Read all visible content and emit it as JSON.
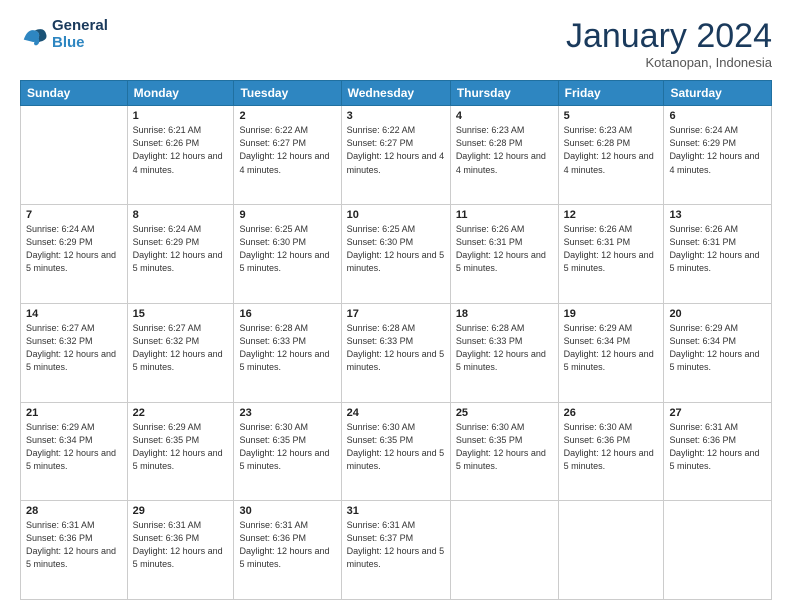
{
  "logo": {
    "line1": "General",
    "line2": "Blue"
  },
  "title": "January 2024",
  "subtitle": "Kotanopan, Indonesia",
  "days_header": [
    "Sunday",
    "Monday",
    "Tuesday",
    "Wednesday",
    "Thursday",
    "Friday",
    "Saturday"
  ],
  "weeks": [
    [
      {
        "num": "",
        "sunrise": "",
        "sunset": "",
        "daylight": ""
      },
      {
        "num": "1",
        "sunrise": "Sunrise: 6:21 AM",
        "sunset": "Sunset: 6:26 PM",
        "daylight": "Daylight: 12 hours and 4 minutes."
      },
      {
        "num": "2",
        "sunrise": "Sunrise: 6:22 AM",
        "sunset": "Sunset: 6:27 PM",
        "daylight": "Daylight: 12 hours and 4 minutes."
      },
      {
        "num": "3",
        "sunrise": "Sunrise: 6:22 AM",
        "sunset": "Sunset: 6:27 PM",
        "daylight": "Daylight: 12 hours and 4 minutes."
      },
      {
        "num": "4",
        "sunrise": "Sunrise: 6:23 AM",
        "sunset": "Sunset: 6:28 PM",
        "daylight": "Daylight: 12 hours and 4 minutes."
      },
      {
        "num": "5",
        "sunrise": "Sunrise: 6:23 AM",
        "sunset": "Sunset: 6:28 PM",
        "daylight": "Daylight: 12 hours and 4 minutes."
      },
      {
        "num": "6",
        "sunrise": "Sunrise: 6:24 AM",
        "sunset": "Sunset: 6:29 PM",
        "daylight": "Daylight: 12 hours and 4 minutes."
      }
    ],
    [
      {
        "num": "7",
        "sunrise": "Sunrise: 6:24 AM",
        "sunset": "Sunset: 6:29 PM",
        "daylight": "Daylight: 12 hours and 5 minutes."
      },
      {
        "num": "8",
        "sunrise": "Sunrise: 6:24 AM",
        "sunset": "Sunset: 6:29 PM",
        "daylight": "Daylight: 12 hours and 5 minutes."
      },
      {
        "num": "9",
        "sunrise": "Sunrise: 6:25 AM",
        "sunset": "Sunset: 6:30 PM",
        "daylight": "Daylight: 12 hours and 5 minutes."
      },
      {
        "num": "10",
        "sunrise": "Sunrise: 6:25 AM",
        "sunset": "Sunset: 6:30 PM",
        "daylight": "Daylight: 12 hours and 5 minutes."
      },
      {
        "num": "11",
        "sunrise": "Sunrise: 6:26 AM",
        "sunset": "Sunset: 6:31 PM",
        "daylight": "Daylight: 12 hours and 5 minutes."
      },
      {
        "num": "12",
        "sunrise": "Sunrise: 6:26 AM",
        "sunset": "Sunset: 6:31 PM",
        "daylight": "Daylight: 12 hours and 5 minutes."
      },
      {
        "num": "13",
        "sunrise": "Sunrise: 6:26 AM",
        "sunset": "Sunset: 6:31 PM",
        "daylight": "Daylight: 12 hours and 5 minutes."
      }
    ],
    [
      {
        "num": "14",
        "sunrise": "Sunrise: 6:27 AM",
        "sunset": "Sunset: 6:32 PM",
        "daylight": "Daylight: 12 hours and 5 minutes."
      },
      {
        "num": "15",
        "sunrise": "Sunrise: 6:27 AM",
        "sunset": "Sunset: 6:32 PM",
        "daylight": "Daylight: 12 hours and 5 minutes."
      },
      {
        "num": "16",
        "sunrise": "Sunrise: 6:28 AM",
        "sunset": "Sunset: 6:33 PM",
        "daylight": "Daylight: 12 hours and 5 minutes."
      },
      {
        "num": "17",
        "sunrise": "Sunrise: 6:28 AM",
        "sunset": "Sunset: 6:33 PM",
        "daylight": "Daylight: 12 hours and 5 minutes."
      },
      {
        "num": "18",
        "sunrise": "Sunrise: 6:28 AM",
        "sunset": "Sunset: 6:33 PM",
        "daylight": "Daylight: 12 hours and 5 minutes."
      },
      {
        "num": "19",
        "sunrise": "Sunrise: 6:29 AM",
        "sunset": "Sunset: 6:34 PM",
        "daylight": "Daylight: 12 hours and 5 minutes."
      },
      {
        "num": "20",
        "sunrise": "Sunrise: 6:29 AM",
        "sunset": "Sunset: 6:34 PM",
        "daylight": "Daylight: 12 hours and 5 minutes."
      }
    ],
    [
      {
        "num": "21",
        "sunrise": "Sunrise: 6:29 AM",
        "sunset": "Sunset: 6:34 PM",
        "daylight": "Daylight: 12 hours and 5 minutes."
      },
      {
        "num": "22",
        "sunrise": "Sunrise: 6:29 AM",
        "sunset": "Sunset: 6:35 PM",
        "daylight": "Daylight: 12 hours and 5 minutes."
      },
      {
        "num": "23",
        "sunrise": "Sunrise: 6:30 AM",
        "sunset": "Sunset: 6:35 PM",
        "daylight": "Daylight: 12 hours and 5 minutes."
      },
      {
        "num": "24",
        "sunrise": "Sunrise: 6:30 AM",
        "sunset": "Sunset: 6:35 PM",
        "daylight": "Daylight: 12 hours and 5 minutes."
      },
      {
        "num": "25",
        "sunrise": "Sunrise: 6:30 AM",
        "sunset": "Sunset: 6:35 PM",
        "daylight": "Daylight: 12 hours and 5 minutes."
      },
      {
        "num": "26",
        "sunrise": "Sunrise: 6:30 AM",
        "sunset": "Sunset: 6:36 PM",
        "daylight": "Daylight: 12 hours and 5 minutes."
      },
      {
        "num": "27",
        "sunrise": "Sunrise: 6:31 AM",
        "sunset": "Sunset: 6:36 PM",
        "daylight": "Daylight: 12 hours and 5 minutes."
      }
    ],
    [
      {
        "num": "28",
        "sunrise": "Sunrise: 6:31 AM",
        "sunset": "Sunset: 6:36 PM",
        "daylight": "Daylight: 12 hours and 5 minutes."
      },
      {
        "num": "29",
        "sunrise": "Sunrise: 6:31 AM",
        "sunset": "Sunset: 6:36 PM",
        "daylight": "Daylight: 12 hours and 5 minutes."
      },
      {
        "num": "30",
        "sunrise": "Sunrise: 6:31 AM",
        "sunset": "Sunset: 6:36 PM",
        "daylight": "Daylight: 12 hours and 5 minutes."
      },
      {
        "num": "31",
        "sunrise": "Sunrise: 6:31 AM",
        "sunset": "Sunset: 6:37 PM",
        "daylight": "Daylight: 12 hours and 5 minutes."
      },
      {
        "num": "",
        "sunrise": "",
        "sunset": "",
        "daylight": ""
      },
      {
        "num": "",
        "sunrise": "",
        "sunset": "",
        "daylight": ""
      },
      {
        "num": "",
        "sunrise": "",
        "sunset": "",
        "daylight": ""
      }
    ]
  ]
}
